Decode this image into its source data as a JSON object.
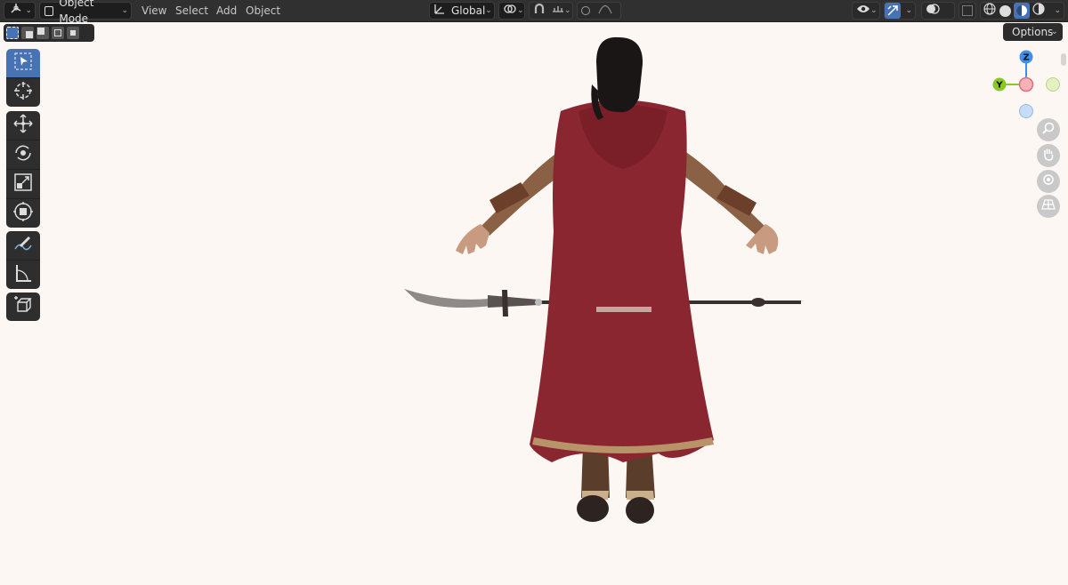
{
  "header": {
    "editor_type_icon": "3d-viewport-icon",
    "mode": "Object Mode",
    "menus": [
      "View",
      "Select",
      "Add",
      "Object"
    ],
    "transform_orientation": "Global"
  },
  "sub_header": {
    "options_label": "Options"
  },
  "toolbar": {
    "tools": [
      "select-box",
      "cursor",
      "move",
      "rotate",
      "scale",
      "transform",
      "annotate",
      "measure",
      "add-cube"
    ]
  },
  "gizmo": {
    "z_label": "Z",
    "y_label": "Y"
  },
  "colors": {
    "accent": "#4772b3",
    "header_bg": "#303030",
    "viewport_bg": "#fdf7f4",
    "cape": "#8a2630",
    "x_axis": "#f08a95",
    "y_axis": "#8ac627",
    "z_axis": "#3f8ff0"
  }
}
